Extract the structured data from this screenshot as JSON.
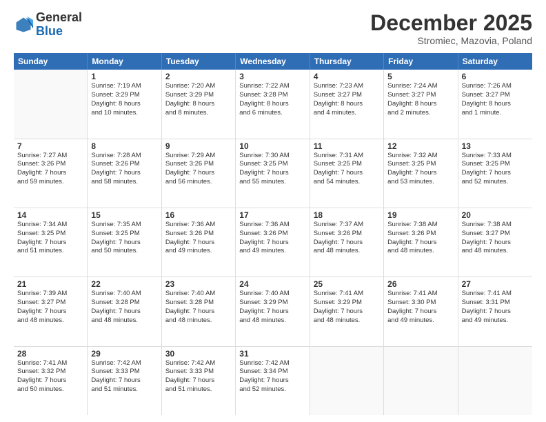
{
  "header": {
    "logo_general": "General",
    "logo_blue": "Blue",
    "month_title": "December 2025",
    "subtitle": "Stromiec, Mazovia, Poland"
  },
  "days_of_week": [
    "Sunday",
    "Monday",
    "Tuesday",
    "Wednesday",
    "Thursday",
    "Friday",
    "Saturday"
  ],
  "weeks": [
    [
      {
        "day": "",
        "lines": []
      },
      {
        "day": "1",
        "lines": [
          "Sunrise: 7:19 AM",
          "Sunset: 3:29 PM",
          "Daylight: 8 hours",
          "and 10 minutes."
        ]
      },
      {
        "day": "2",
        "lines": [
          "Sunrise: 7:20 AM",
          "Sunset: 3:29 PM",
          "Daylight: 8 hours",
          "and 8 minutes."
        ]
      },
      {
        "day": "3",
        "lines": [
          "Sunrise: 7:22 AM",
          "Sunset: 3:28 PM",
          "Daylight: 8 hours",
          "and 6 minutes."
        ]
      },
      {
        "day": "4",
        "lines": [
          "Sunrise: 7:23 AM",
          "Sunset: 3:27 PM",
          "Daylight: 8 hours",
          "and 4 minutes."
        ]
      },
      {
        "day": "5",
        "lines": [
          "Sunrise: 7:24 AM",
          "Sunset: 3:27 PM",
          "Daylight: 8 hours",
          "and 2 minutes."
        ]
      },
      {
        "day": "6",
        "lines": [
          "Sunrise: 7:26 AM",
          "Sunset: 3:27 PM",
          "Daylight: 8 hours",
          "and 1 minute."
        ]
      }
    ],
    [
      {
        "day": "7",
        "lines": [
          "Sunrise: 7:27 AM",
          "Sunset: 3:26 PM",
          "Daylight: 7 hours",
          "and 59 minutes."
        ]
      },
      {
        "day": "8",
        "lines": [
          "Sunrise: 7:28 AM",
          "Sunset: 3:26 PM",
          "Daylight: 7 hours",
          "and 58 minutes."
        ]
      },
      {
        "day": "9",
        "lines": [
          "Sunrise: 7:29 AM",
          "Sunset: 3:26 PM",
          "Daylight: 7 hours",
          "and 56 minutes."
        ]
      },
      {
        "day": "10",
        "lines": [
          "Sunrise: 7:30 AM",
          "Sunset: 3:25 PM",
          "Daylight: 7 hours",
          "and 55 minutes."
        ]
      },
      {
        "day": "11",
        "lines": [
          "Sunrise: 7:31 AM",
          "Sunset: 3:25 PM",
          "Daylight: 7 hours",
          "and 54 minutes."
        ]
      },
      {
        "day": "12",
        "lines": [
          "Sunrise: 7:32 AM",
          "Sunset: 3:25 PM",
          "Daylight: 7 hours",
          "and 53 minutes."
        ]
      },
      {
        "day": "13",
        "lines": [
          "Sunrise: 7:33 AM",
          "Sunset: 3:25 PM",
          "Daylight: 7 hours",
          "and 52 minutes."
        ]
      }
    ],
    [
      {
        "day": "14",
        "lines": [
          "Sunrise: 7:34 AM",
          "Sunset: 3:25 PM",
          "Daylight: 7 hours",
          "and 51 minutes."
        ]
      },
      {
        "day": "15",
        "lines": [
          "Sunrise: 7:35 AM",
          "Sunset: 3:25 PM",
          "Daylight: 7 hours",
          "and 50 minutes."
        ]
      },
      {
        "day": "16",
        "lines": [
          "Sunrise: 7:36 AM",
          "Sunset: 3:26 PM",
          "Daylight: 7 hours",
          "and 49 minutes."
        ]
      },
      {
        "day": "17",
        "lines": [
          "Sunrise: 7:36 AM",
          "Sunset: 3:26 PM",
          "Daylight: 7 hours",
          "and 49 minutes."
        ]
      },
      {
        "day": "18",
        "lines": [
          "Sunrise: 7:37 AM",
          "Sunset: 3:26 PM",
          "Daylight: 7 hours",
          "and 48 minutes."
        ]
      },
      {
        "day": "19",
        "lines": [
          "Sunrise: 7:38 AM",
          "Sunset: 3:26 PM",
          "Daylight: 7 hours",
          "and 48 minutes."
        ]
      },
      {
        "day": "20",
        "lines": [
          "Sunrise: 7:38 AM",
          "Sunset: 3:27 PM",
          "Daylight: 7 hours",
          "and 48 minutes."
        ]
      }
    ],
    [
      {
        "day": "21",
        "lines": [
          "Sunrise: 7:39 AM",
          "Sunset: 3:27 PM",
          "Daylight: 7 hours",
          "and 48 minutes."
        ]
      },
      {
        "day": "22",
        "lines": [
          "Sunrise: 7:40 AM",
          "Sunset: 3:28 PM",
          "Daylight: 7 hours",
          "and 48 minutes."
        ]
      },
      {
        "day": "23",
        "lines": [
          "Sunrise: 7:40 AM",
          "Sunset: 3:28 PM",
          "Daylight: 7 hours",
          "and 48 minutes."
        ]
      },
      {
        "day": "24",
        "lines": [
          "Sunrise: 7:40 AM",
          "Sunset: 3:29 PM",
          "Daylight: 7 hours",
          "and 48 minutes."
        ]
      },
      {
        "day": "25",
        "lines": [
          "Sunrise: 7:41 AM",
          "Sunset: 3:29 PM",
          "Daylight: 7 hours",
          "and 48 minutes."
        ]
      },
      {
        "day": "26",
        "lines": [
          "Sunrise: 7:41 AM",
          "Sunset: 3:30 PM",
          "Daylight: 7 hours",
          "and 49 minutes."
        ]
      },
      {
        "day": "27",
        "lines": [
          "Sunrise: 7:41 AM",
          "Sunset: 3:31 PM",
          "Daylight: 7 hours",
          "and 49 minutes."
        ]
      }
    ],
    [
      {
        "day": "28",
        "lines": [
          "Sunrise: 7:41 AM",
          "Sunset: 3:32 PM",
          "Daylight: 7 hours",
          "and 50 minutes."
        ]
      },
      {
        "day": "29",
        "lines": [
          "Sunrise: 7:42 AM",
          "Sunset: 3:33 PM",
          "Daylight: 7 hours",
          "and 51 minutes."
        ]
      },
      {
        "day": "30",
        "lines": [
          "Sunrise: 7:42 AM",
          "Sunset: 3:33 PM",
          "Daylight: 7 hours",
          "and 51 minutes."
        ]
      },
      {
        "day": "31",
        "lines": [
          "Sunrise: 7:42 AM",
          "Sunset: 3:34 PM",
          "Daylight: 7 hours",
          "and 52 minutes."
        ]
      },
      {
        "day": "",
        "lines": []
      },
      {
        "day": "",
        "lines": []
      },
      {
        "day": "",
        "lines": []
      }
    ]
  ]
}
